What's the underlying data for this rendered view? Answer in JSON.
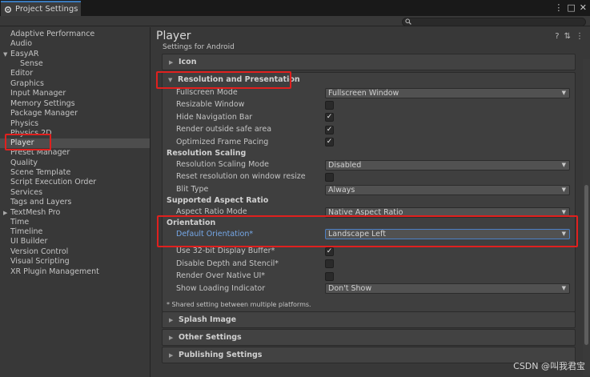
{
  "window": {
    "tab_title": "Project Settings",
    "controls": [
      "⋮",
      "□",
      "✕"
    ]
  },
  "sidebar": {
    "items": [
      {
        "label": "Adaptive Performance"
      },
      {
        "label": "Audio"
      },
      {
        "label": "EasyAR"
      },
      {
        "label": "Sense"
      },
      {
        "label": "Editor"
      },
      {
        "label": "Graphics"
      },
      {
        "label": "Input Manager"
      },
      {
        "label": "Memory Settings"
      },
      {
        "label": "Package Manager"
      },
      {
        "label": "Physics"
      },
      {
        "label": "Physics 2D"
      },
      {
        "label": "Player"
      },
      {
        "label": "Preset Manager"
      },
      {
        "label": "Quality"
      },
      {
        "label": "Scene Template"
      },
      {
        "label": "Script Execution Order"
      },
      {
        "label": "Services"
      },
      {
        "label": "Tags and Layers"
      },
      {
        "label": "TextMesh Pro"
      },
      {
        "label": "Time"
      },
      {
        "label": "Timeline"
      },
      {
        "label": "UI Builder"
      },
      {
        "label": "Version Control"
      },
      {
        "label": "Visual Scripting"
      },
      {
        "label": "XR Plugin Management"
      }
    ],
    "selected": "Player"
  },
  "main": {
    "title": "Player",
    "subtitle": "Settings for Android",
    "icon_section": "Icon",
    "resolution_section": "Resolution and Presentation",
    "fullscreen_mode_label": "Fullscreen Mode",
    "fullscreen_mode_value": "Fullscreen Window",
    "resizable_window_label": "Resizable Window",
    "hide_nav_bar_label": "Hide Navigation Bar",
    "render_safe_area_label": "Render outside safe area",
    "optimized_frame_pacing_label": "Optimized Frame Pacing",
    "resolution_scaling_header": "Resolution Scaling",
    "scaling_mode_label": "Resolution Scaling Mode",
    "scaling_mode_value": "Disabled",
    "reset_resolution_label": "Reset resolution on window resize",
    "blit_type_label": "Blit Type",
    "blit_type_value": "Always",
    "aspect_header": "Supported Aspect Ratio",
    "aspect_mode_label": "Aspect Ratio Mode",
    "aspect_mode_value": "Native Aspect Ratio",
    "orientation_header": "Orientation",
    "default_orientation_label": "Default Orientation*",
    "default_orientation_value": "Landscape Left",
    "display_buffer_label": "Use 32-bit Display Buffer*",
    "disable_depth_label": "Disable Depth and Stencil*",
    "render_native_ui_label": "Render Over Native UI*",
    "loading_indicator_label": "Show Loading Indicator",
    "loading_indicator_value": "Don't Show",
    "shared_note": "* Shared setting between multiple platforms.",
    "splash_section": "Splash Image",
    "other_section": "Other Settings",
    "publishing_section": "Publishing Settings",
    "header_icons": [
      "?",
      "⇅",
      "⋮"
    ]
  },
  "checkbox_states": {
    "resizable_window": false,
    "hide_navigation_bar": true,
    "render_outside_safe_area": true,
    "optimized_frame_pacing": true,
    "reset_resolution": false,
    "use_32bit_display_buffer": true,
    "disable_depth_and_stencil": false,
    "render_over_native_ui": false
  },
  "watermark": "CSDN @叫我君宝",
  "colors": {
    "accent_blue": "#76a8e8",
    "annotation_red": "#e0201e",
    "tab_accent": "#3a79bb"
  }
}
